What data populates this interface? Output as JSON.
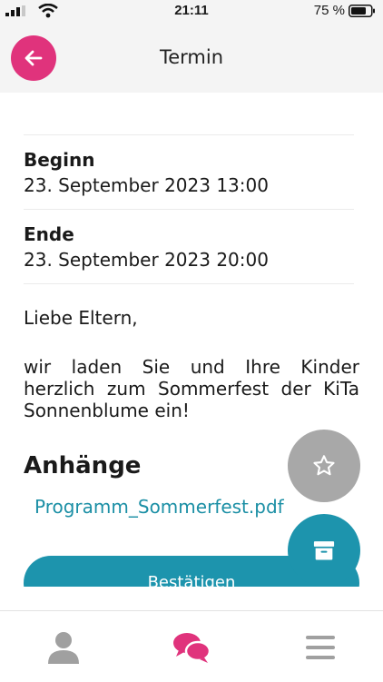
{
  "statusbar": {
    "time": "21:11",
    "battery_pct": "75 %"
  },
  "header": {
    "title": "Termin"
  },
  "event": {
    "begin_label": "Beginn",
    "begin_value": "23. September 2023 13:00",
    "end_label": "Ende",
    "end_value": "23. September 2023 20:00",
    "greeting": "Liebe Eltern,",
    "message": "wir laden Sie und Ihre Kinder herzlich zum Sommerfest der KiTa Sonnenblume ein!"
  },
  "attachments": {
    "title": "Anhänge",
    "files": [
      "Programm_Sommerfest.pdf"
    ]
  },
  "actions": {
    "confirm_label": "Bestätigen"
  },
  "icons": {
    "back": "arrow-left-icon",
    "favorite": "star-icon",
    "archive": "archive-icon",
    "profile": "person-icon",
    "chat": "chat-bubbles-icon",
    "menu": "hamburger-menu-icon"
  },
  "colors": {
    "accent_pink": "#e0337c",
    "accent_teal": "#1d94ad",
    "link": "#1b8fa5",
    "fab_grey": "#a8a8a8"
  }
}
